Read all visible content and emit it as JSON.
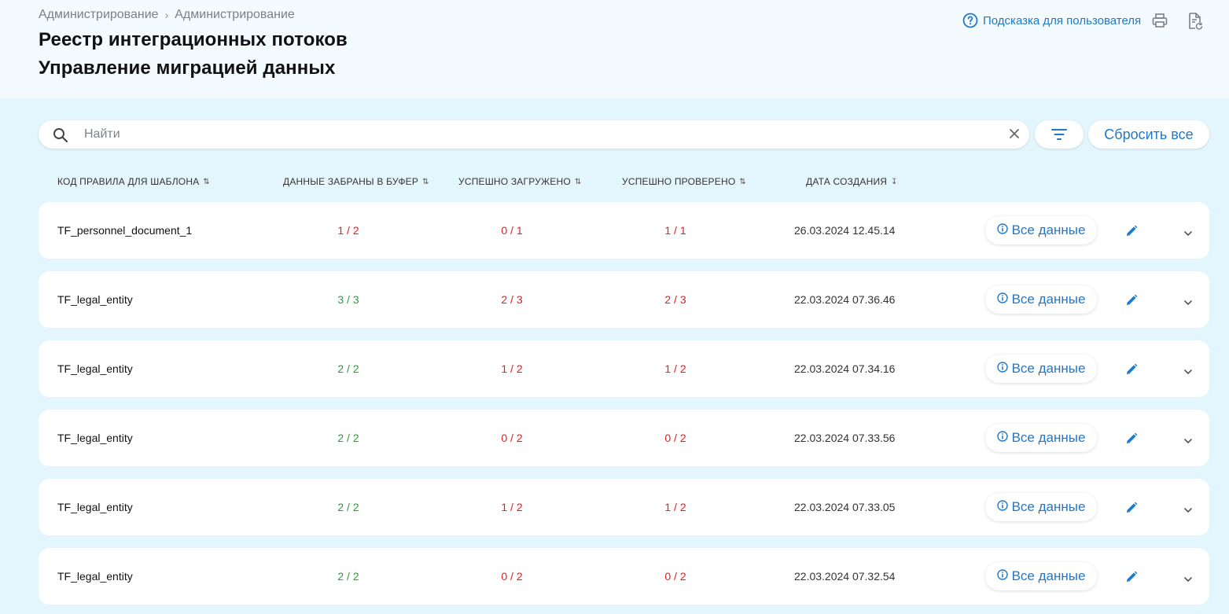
{
  "breadcrumb": [
    "Администрирование",
    "Администрирование"
  ],
  "title_line1": "Реестр интеграционных потоков",
  "title_line2": "Управление миграцией данных",
  "header": {
    "hint_label": "Подсказка для пользователя"
  },
  "search": {
    "placeholder": "Найти",
    "value": ""
  },
  "reset_label": "Сбросить все",
  "columns": [
    "КОД ПРАВИЛА ДЛЯ ШАБЛОНА",
    "ДАННЫЕ ЗАБРАНЫ В БУФЕР",
    "УСПЕШНО ЗАГРУЖЕНО",
    "УСПЕШНО ПРОВЕРЕНО",
    "ДАТА СОЗДАНИЯ"
  ],
  "all_data_label": "Все данные",
  "colors": {
    "accent": "#1f78c9",
    "ok": "#2a9d36",
    "error": "#e02020",
    "background": "#e4f6fd"
  },
  "rows": [
    {
      "code": "TF_personnel_document_1",
      "buffer": "1 / 2",
      "buffer_status": "red",
      "loaded": "0 / 1",
      "loaded_status": "red",
      "checked": "1 / 1",
      "checked_status": "red",
      "created": "26.03.2024 12.45.14"
    },
    {
      "code": "TF_legal_entity",
      "buffer": "3 / 3",
      "buffer_status": "green",
      "loaded": "2 / 3",
      "loaded_status": "red",
      "checked": "2 / 3",
      "checked_status": "red",
      "created": "22.03.2024 07.36.46"
    },
    {
      "code": "TF_legal_entity",
      "buffer": "2 / 2",
      "buffer_status": "green",
      "loaded": "1 / 2",
      "loaded_status": "red",
      "checked": "1 / 2",
      "checked_status": "red",
      "created": "22.03.2024 07.34.16"
    },
    {
      "code": "TF_legal_entity",
      "buffer": "2 / 2",
      "buffer_status": "green",
      "loaded": "0 / 2",
      "loaded_status": "red",
      "checked": "0 / 2",
      "checked_status": "red",
      "created": "22.03.2024 07.33.56"
    },
    {
      "code": "TF_legal_entity",
      "buffer": "2 / 2",
      "buffer_status": "green",
      "loaded": "1 / 2",
      "loaded_status": "red",
      "checked": "1 / 2",
      "checked_status": "red",
      "created": "22.03.2024 07.33.05"
    },
    {
      "code": "TF_legal_entity",
      "buffer": "2 / 2",
      "buffer_status": "green",
      "loaded": "0 / 2",
      "loaded_status": "red",
      "checked": "0 / 2",
      "checked_status": "red",
      "created": "22.03.2024 07.32.54"
    }
  ]
}
